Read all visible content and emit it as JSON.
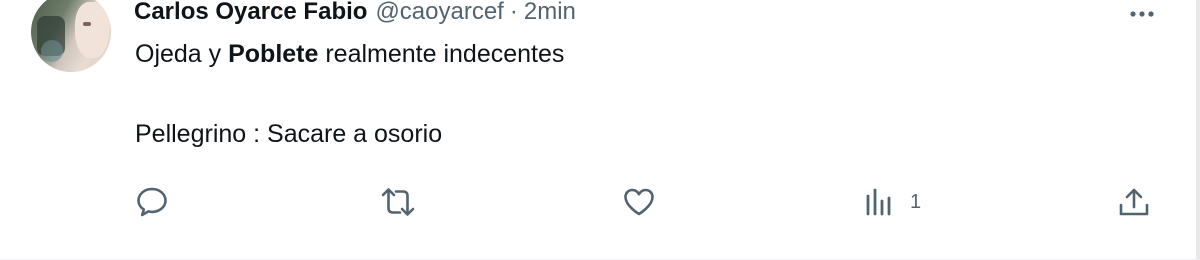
{
  "tweet": {
    "author_name": "Carlos Oyarce Fabio",
    "handle": "@caoyarcef",
    "separator": "·",
    "time": "2min",
    "text": {
      "line1": {
        "before": "Ojeda y ",
        "bold": "Poblete",
        "after": " realmente indecentes"
      },
      "line2": "Pellegrino : Sacare a osorio"
    },
    "actions": {
      "views_count": "1"
    }
  },
  "colors": {
    "text_primary": "#0f1419",
    "text_secondary": "#536471",
    "border": "#eff3f4"
  },
  "icons": [
    "more-icon",
    "reply-icon",
    "retweet-icon",
    "like-icon",
    "views-icon",
    "share-icon"
  ]
}
